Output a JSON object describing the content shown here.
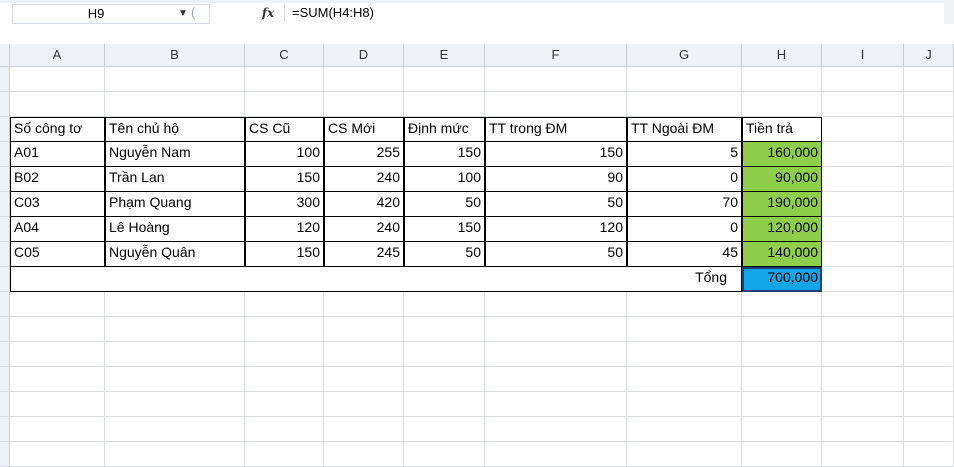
{
  "formula_bar": {
    "name_box": "H9",
    "fx_label": "fx",
    "formula": "=SUM(H4:H8)"
  },
  "columns": [
    "A",
    "B",
    "C",
    "D",
    "E",
    "F",
    "G",
    "H",
    "I",
    "J"
  ],
  "table": {
    "headers": [
      "Số công tơ",
      "Tên chủ hộ",
      "CS Cũ",
      "CS Mới",
      "Định mức",
      "TT trong ĐM",
      "TT Ngoài ĐM",
      "Tiền trả"
    ],
    "rows": [
      [
        "A01",
        "Nguyễn Nam",
        "100",
        "255",
        "150",
        "150",
        "5",
        "160,000"
      ],
      [
        "B02",
        "Trần Lan",
        "150",
        "240",
        "100",
        "90",
        "0",
        "90,000"
      ],
      [
        "C03",
        "Phạm Quang",
        "300",
        "420",
        "50",
        "50",
        "70",
        "190,000"
      ],
      [
        "A04",
        "Lê Hoàng",
        "120",
        "240",
        "150",
        "120",
        "0",
        "120,000"
      ],
      [
        "C05",
        "Nguyễn Quân",
        "150",
        "245",
        "50",
        "50",
        "45",
        "140,000"
      ]
    ],
    "total_label": "Tổng",
    "total_value": "700,000"
  },
  "colors": {
    "tien_tra_fill": "#8fce4a",
    "total_fill": "#12a6e6"
  }
}
